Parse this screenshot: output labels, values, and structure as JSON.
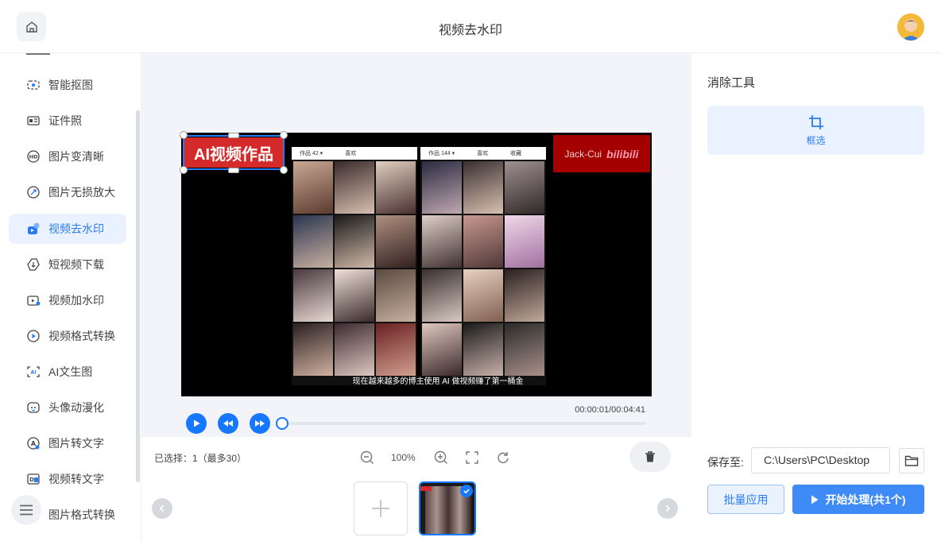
{
  "header": {
    "title": "视频去水印"
  },
  "sidebar": {
    "items": [
      {
        "label": "智能抠图",
        "icon": "cutout-icon"
      },
      {
        "label": "证件照",
        "icon": "id-photo-icon"
      },
      {
        "label": "图片变清晰",
        "icon": "hd-icon"
      },
      {
        "label": "图片无损放大",
        "icon": "enlarge-icon"
      },
      {
        "label": "视频去水印",
        "icon": "video-watermark-remove-icon",
        "active": true
      },
      {
        "label": "短视频下载",
        "icon": "download-icon"
      },
      {
        "label": "视频加水印",
        "icon": "video-watermark-add-icon"
      },
      {
        "label": "视频格式转换",
        "icon": "video-convert-icon"
      },
      {
        "label": "AI文生图",
        "icon": "ai-image-icon"
      },
      {
        "label": "头像动漫化",
        "icon": "anime-avatar-icon"
      },
      {
        "label": "图片转文字",
        "icon": "image-to-text-icon"
      },
      {
        "label": "视频转文字",
        "icon": "video-to-text-icon"
      },
      {
        "label": "图片格式转换",
        "icon": "image-convert-icon"
      }
    ]
  },
  "video": {
    "watermark_left": "AI视频作品",
    "watermark_right_name": "Jack-Cui",
    "watermark_right_logo": "bilibili",
    "phone1_tab1": "作品 42 ▾",
    "phone1_tab2": "喜欢",
    "phone2_tab1": "作品 144 ▾",
    "phone2_tab2": "喜欢",
    "phone2_tab3": "收藏",
    "subtitle": "现在越来越多的博主使用 AI 做视频赚了第一桶金",
    "time": "00:00:01/00:04:41",
    "progress": 0.0
  },
  "toolbar": {
    "selected_text": "已选择：1（最多30）",
    "zoom": "100%"
  },
  "panel": {
    "title": "消除工具",
    "tool_label": "框选",
    "save_label": "保存至:",
    "save_path": "C:\\Users\\PC\\Desktop",
    "batch_label": "批量应用",
    "start_label": "开始处理(共1个)"
  },
  "colors": {
    "accent": "#1677ff",
    "active_bg": "#eaf2ff",
    "watermark_red": "#d42a2a"
  }
}
